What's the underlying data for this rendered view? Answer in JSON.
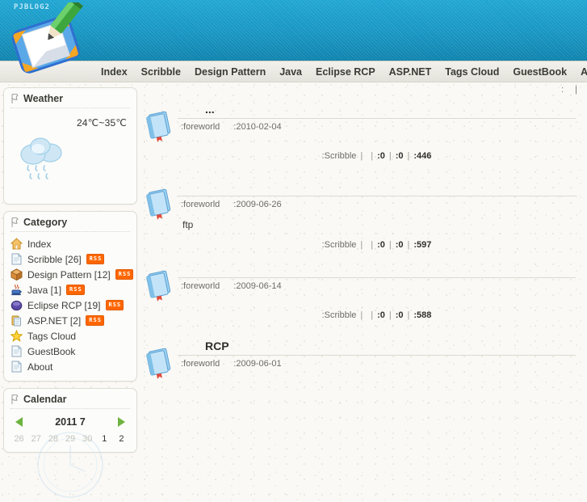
{
  "site": {
    "logo_text": "PJBLOG2",
    "banner_color": "#1899c4",
    "accent_color": "#f60"
  },
  "nav": {
    "items": [
      {
        "label": "Index"
      },
      {
        "label": "Scribble"
      },
      {
        "label": "Design Pattern"
      },
      {
        "label": "Java"
      },
      {
        "label": "Eclipse RCP"
      },
      {
        "label": "ASP.NET"
      },
      {
        "label": "Tags Cloud"
      },
      {
        "label": "GuestBook"
      },
      {
        "label": "About"
      }
    ]
  },
  "sidebar": {
    "weather": {
      "title": "Weather",
      "icon": "flag-icon",
      "temperature": "24℃~35℃",
      "condition_icon": "rain-cloud-icon"
    },
    "category": {
      "title": "Category",
      "icon": "flag-icon",
      "items": [
        {
          "label": "Index",
          "icon": "home-icon",
          "rss": false
        },
        {
          "label": "Scribble [26]",
          "icon": "document-icon",
          "rss": true,
          "rss_label": "RSS"
        },
        {
          "label": "Design Pattern [12]",
          "icon": "box-icon",
          "rss": true,
          "rss_label": "RSS"
        },
        {
          "label": "Java [1]",
          "icon": "coffee-cup-icon",
          "rss": true,
          "rss_label": "RSS"
        },
        {
          "label": "Eclipse RCP [19]",
          "icon": "sphere-icon",
          "rss": true,
          "rss_label": "RSS"
        },
        {
          "label": "ASP.NET [2]",
          "icon": "clipboard-icon",
          "rss": true,
          "rss_label": "RSS"
        },
        {
          "label": "Tags Cloud",
          "icon": "star-icon",
          "rss": false
        },
        {
          "label": "GuestBook",
          "icon": "document-icon",
          "rss": false
        },
        {
          "label": "About",
          "icon": "document-icon",
          "rss": false
        }
      ]
    },
    "calendar": {
      "title": "Calendar",
      "icon": "flag-icon",
      "prev_label": "◀",
      "next_label": "▶",
      "current": "2011  7",
      "days": [
        {
          "n": "26",
          "outside": true
        },
        {
          "n": "27",
          "outside": true
        },
        {
          "n": "28",
          "outside": true
        },
        {
          "n": "29",
          "outside": true
        },
        {
          "n": "30",
          "outside": true
        },
        {
          "n": "1",
          "outside": false
        },
        {
          "n": "2",
          "outside": false
        }
      ]
    }
  },
  "main": {
    "topbar": {
      "left_mark": ":",
      "right_mark": "|"
    },
    "posts": [
      {
        "icon": "book-icon",
        "title": "...",
        "author": ":foreworld",
        "date": ":2010-02-04",
        "body": "",
        "footer": {
          "category": ":Scribble",
          "tag": "",
          "comments": ":0",
          "trackbacks": ":0",
          "views": ":446"
        }
      },
      {
        "icon": "book-icon",
        "title": "",
        "author": ":foreworld",
        "date": ":2009-06-26",
        "body": "ftp",
        "footer": {
          "category": ":Scribble",
          "tag": "",
          "comments": ":0",
          "trackbacks": ":0",
          "views": ":597"
        }
      },
      {
        "icon": "book-icon",
        "title": "",
        "author": ":foreworld",
        "date": ":2009-06-14",
        "body": "",
        "footer": {
          "category": ":Scribble",
          "tag": "",
          "comments": ":0",
          "trackbacks": ":0",
          "views": ":588"
        }
      },
      {
        "icon": "book-icon",
        "title": "RCP",
        "author": ":foreworld",
        "date": ":2009-06-01",
        "body": "",
        "footer": {
          "category": "",
          "tag": "",
          "comments": "",
          "trackbacks": "",
          "views": ""
        }
      }
    ]
  }
}
